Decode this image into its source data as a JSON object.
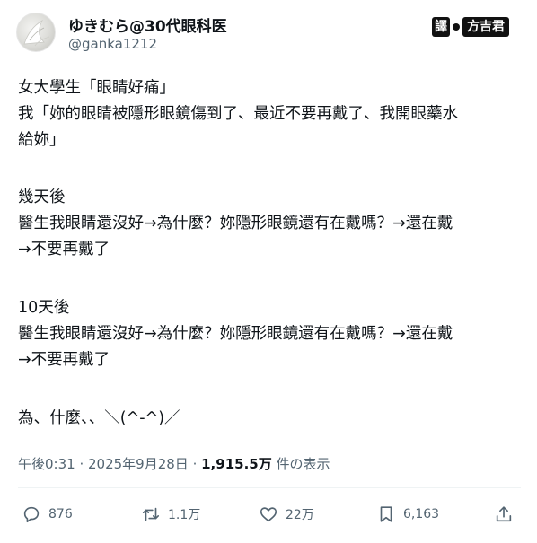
{
  "author": {
    "display_name": "ゆきむら@30代眼科医",
    "handle": "@ganka1212"
  },
  "badge": {
    "yi": "譯",
    "fang": "方吉君"
  },
  "tweet": {
    "lines": [
      "女大學生「眼睛好痛」",
      "我「妳的眼睛被隱形眼鏡傷到了、最近不要再戴了、我開眼藥水",
      "給妳」",
      "幾天後",
      "醫生我眼睛還沒好→為什麼？妳隱形眼鏡還有在戴嗎？→還在戴",
      "→不要再戴了",
      "10天後",
      "醫生我眼睛還沒好→為什麼？妳隱形眼鏡還有在戴嗎？→還在戴",
      "→不要再戴了",
      "為、什麼、、＼(^-^)／"
    ]
  },
  "meta": {
    "time": "午後0:31",
    "sep1": " · ",
    "date": "2025年9月28日",
    "sep2": " · ",
    "views": "1,915.5万",
    "views_suffix": " 件の表示"
  },
  "actions": {
    "reply_count": "876",
    "retweet_count": "1.1万",
    "like_count": "22万",
    "bookmark_count": "6,163"
  },
  "colors": {
    "text": "#0f1419",
    "secondary": "#536471",
    "divider": "#eff3f4"
  },
  "icons": [
    "reply-icon",
    "retweet-icon",
    "like-icon",
    "bookmark-icon",
    "share-icon"
  ]
}
